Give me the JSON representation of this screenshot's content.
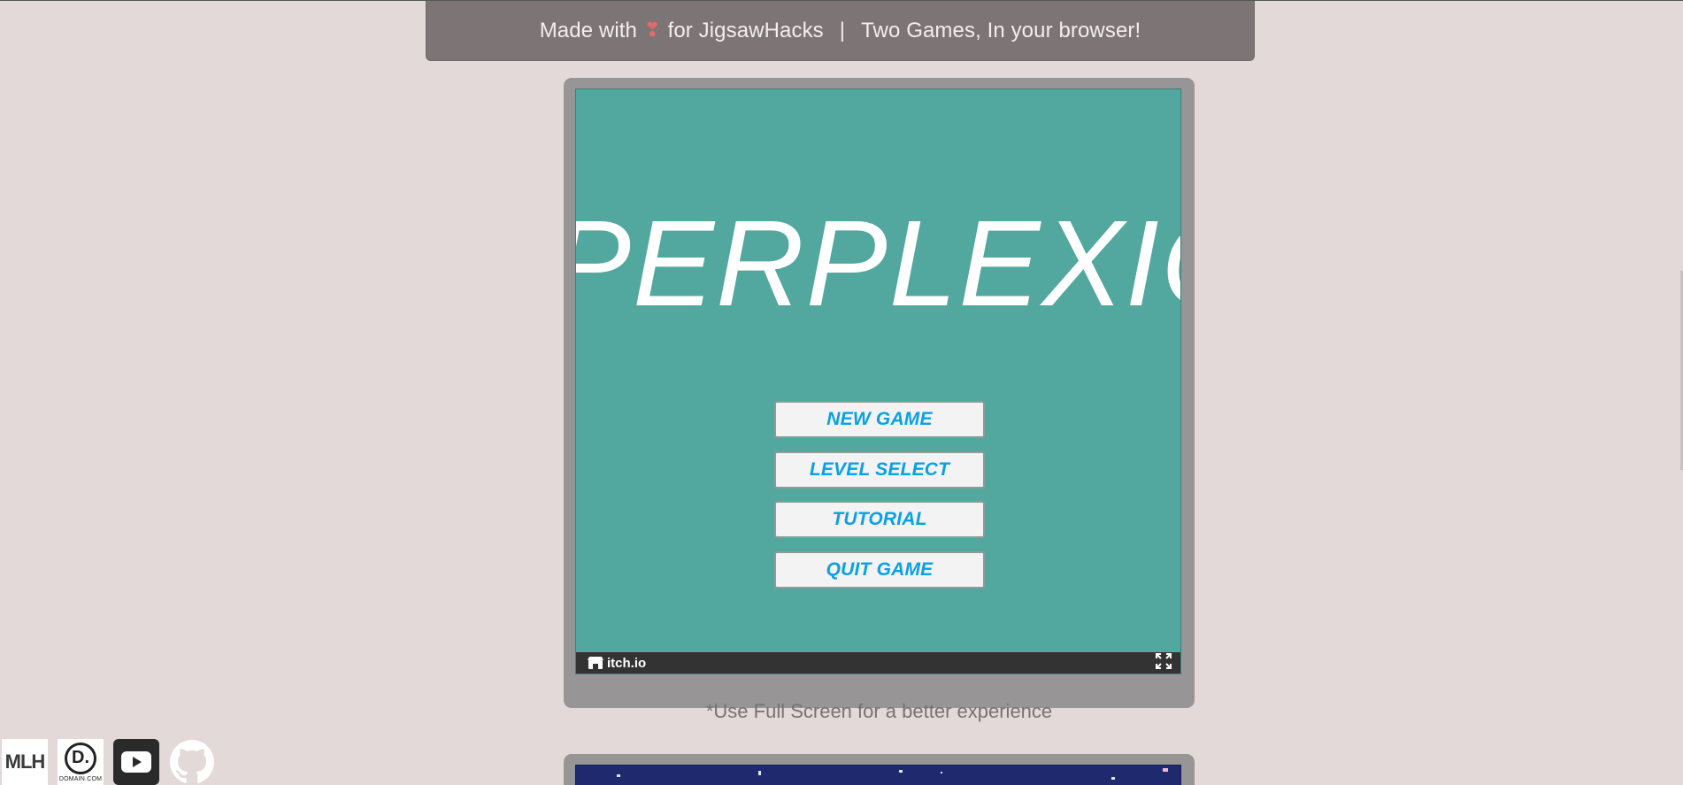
{
  "banner": {
    "made_with": "Made with",
    "heart": "❣",
    "for_text": "for JigsawHacks",
    "separator": "|",
    "tagline": "Two Games, In your browser!"
  },
  "game1": {
    "title": "PERPLEXIC",
    "menu": [
      "NEW GAME",
      "LEVEL SELECT",
      "TUTORIAL",
      "QUIT GAME"
    ],
    "platform_label": "itch.io",
    "fullscreen_icon": "expand-icon"
  },
  "hint": "*Use Full Screen for a better experience",
  "sponsors": {
    "mlh_m": "MLH",
    "mlh_h": "",
    "domain_letter": "D.",
    "domain_text": "DOMAIN.COM",
    "youtube_icon": "youtube-icon",
    "github_icon": "github-icon"
  },
  "colors": {
    "page_bg": "#e2d9d8",
    "banner_bg": "#7d7575",
    "game1_bg": "#52a89e",
    "button_text": "#0aa0e6",
    "game2_bg": "#1f2a6e"
  }
}
